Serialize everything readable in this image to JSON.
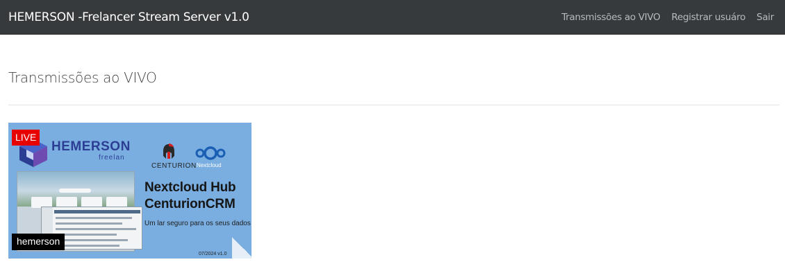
{
  "navbar": {
    "brand": "HEMERSON -Frelancer Stream Server v1.0",
    "links": [
      {
        "label": "Transmissões ao VIVO"
      },
      {
        "label": "Registrar usuáro"
      },
      {
        "label": "Sair"
      }
    ]
  },
  "main": {
    "title": "Transmissões ao VIVO",
    "streams": [
      {
        "badge": "LIVE",
        "user": "hemerson",
        "thumbnail": {
          "logo_text": "HEMERSON",
          "logo_sub": "freelan",
          "centurion_label": "CENTURION",
          "nextcloud_label": "Nextcloud",
          "headline_line1": "Nextcloud Hub",
          "headline_line2": "CenturionCRM",
          "subtitle": "Um lar seguro para os seus dados",
          "version": "07/2024 v1.0"
        }
      }
    ]
  },
  "colors": {
    "navbar_bg": "#373a3c",
    "live_red": "#e60000",
    "thumb_bg": "#7aaee0",
    "logo_blue": "#2c3e94"
  }
}
